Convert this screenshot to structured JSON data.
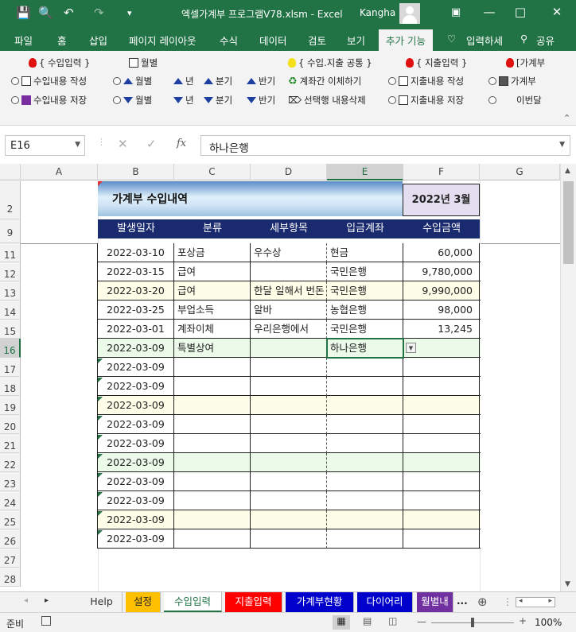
{
  "window": {
    "title": "엑셀가계부 프로그램V78.xlsm  -  Excel",
    "user": "Kangha",
    "controls": [
      "—",
      "□",
      "✕"
    ]
  },
  "quick_access": {
    "save_icon": "💾",
    "preview_icon": "🔍",
    "undo": "↶",
    "redo": "↷",
    "more": "▾"
  },
  "tabs": [
    {
      "label": "파일"
    },
    {
      "label": "홈"
    },
    {
      "label": "삽입"
    },
    {
      "label": "페이지 레이아웃"
    },
    {
      "label": "수식"
    },
    {
      "label": "데이터"
    },
    {
      "label": "검토"
    },
    {
      "label": "보기"
    },
    {
      "label": "추가 기능"
    },
    {
      "label": "입력하세"
    },
    {
      "label": "공유"
    }
  ],
  "ribbon": {
    "groups": {
      "income": "{ 수입입력 }",
      "monthly": "월별",
      "common": "{ 수입.지출 공통 }",
      "expense": "{ 지출입력 }",
      "book": "[가계부"
    },
    "rows": {
      "income_write": "수입내용 작성",
      "income_save": "수입내용 저장",
      "month_up": "월별",
      "year_up": "년",
      "quarter_up": "분기",
      "half_up": "반기",
      "month_dn": "월별",
      "year_dn": "년",
      "quarter_dn": "분기",
      "half_dn": "반기",
      "transfer": "계좌간 이체하기",
      "delete_selected": "선택행 내용삭제",
      "expense_write": "지출내용 작성",
      "expense_save": "지출내용 저장",
      "book_cut": "가계부",
      "thismonth_cut": "이번달"
    }
  },
  "formula_bar": {
    "name_box": "E16",
    "fx": "fx",
    "value": "하나은행"
  },
  "columns": [
    "A",
    "B",
    "C",
    "D",
    "E",
    "F",
    "G"
  ],
  "rows": [
    "2",
    "9",
    "11",
    "12",
    "13",
    "14",
    "15",
    "16",
    "17",
    "18",
    "19",
    "20",
    "21",
    "22",
    "23",
    "24",
    "25",
    "26",
    "27",
    "28"
  ],
  "sheet": {
    "title": "가계부 수입내역",
    "period": "2022년 3월",
    "headers": [
      "발생일자",
      "분류",
      "세부항목",
      "입금계좌",
      "수입금액"
    ],
    "records": [
      {
        "date": "2022-03-10",
        "cat": "포상금",
        "detail": "우수상",
        "account": "현금",
        "amount": "60,000",
        "bg": "#ffffff"
      },
      {
        "date": "2022-03-15",
        "cat": "급여",
        "detail": "",
        "account": "국민은행",
        "amount": "9,780,000",
        "bg": "#ffffff"
      },
      {
        "date": "2022-03-20",
        "cat": "급여",
        "detail": "한달 일해서 번돈",
        "account": "국민은행",
        "amount": "9,990,000",
        "bg": "#fdfde8"
      },
      {
        "date": "2022-03-25",
        "cat": "부업소득",
        "detail": "알바",
        "account": "농협은행",
        "amount": "98,000",
        "bg": "#ffffff"
      },
      {
        "date": "2022-03-01",
        "cat": "계좌이체",
        "detail": "우리은행에서",
        "account": "국민은행",
        "amount": "13,245",
        "bg": "#ffffff"
      },
      {
        "date": "2022-03-09",
        "cat": "특별상여",
        "detail": "",
        "account": "하나은행",
        "amount": "",
        "bg": "#ebfae9"
      },
      {
        "date": "2022-03-09",
        "cat": "",
        "detail": "",
        "account": "",
        "amount": "",
        "bg": "#ffffff"
      },
      {
        "date": "2022-03-09",
        "cat": "",
        "detail": "",
        "account": "",
        "amount": "",
        "bg": "#ffffff"
      },
      {
        "date": "2022-03-09",
        "cat": "",
        "detail": "",
        "account": "",
        "amount": "",
        "bg": "#fdfde8"
      },
      {
        "date": "2022-03-09",
        "cat": "",
        "detail": "",
        "account": "",
        "amount": "",
        "bg": "#ffffff"
      },
      {
        "date": "2022-03-09",
        "cat": "",
        "detail": "",
        "account": "",
        "amount": "",
        "bg": "#ffffff"
      },
      {
        "date": "2022-03-09",
        "cat": "",
        "detail": "",
        "account": "",
        "amount": "",
        "bg": "#ebfae9"
      },
      {
        "date": "2022-03-09",
        "cat": "",
        "detail": "",
        "account": "",
        "amount": "",
        "bg": "#ffffff"
      },
      {
        "date": "2022-03-09",
        "cat": "",
        "detail": "",
        "account": "",
        "amount": "",
        "bg": "#ffffff"
      },
      {
        "date": "2022-03-09",
        "cat": "",
        "detail": "",
        "account": "",
        "amount": "",
        "bg": "#fdfde8"
      },
      {
        "date": "2022-03-09",
        "cat": "",
        "detail": "",
        "account": "",
        "amount": "",
        "bg": "#ffffff"
      }
    ]
  },
  "sheet_tabs": [
    {
      "label": "Help",
      "bg": "#f2f2f2",
      "fg": "#333333"
    },
    {
      "label": "설정",
      "bg": "#ffc000",
      "fg": "#222222"
    },
    {
      "label": "수입입력",
      "bg": "#ffffff",
      "fg": "#217346"
    },
    {
      "label": "지출입력",
      "bg": "#ff0000",
      "fg": "#ffffff"
    },
    {
      "label": "가계부현황",
      "bg": "#0000cc",
      "fg": "#ffffff"
    },
    {
      "label": "다이어리",
      "bg": "#0000cc",
      "fg": "#ffffff"
    },
    {
      "label": "월별내",
      "bg": "#7030a0",
      "fg": "#ffffff"
    }
  ],
  "sheet_nav": {
    "next": "▸",
    "more": "...",
    "add": "⊕"
  },
  "status": {
    "mode": "준비",
    "zoom": "100%",
    "minus": "—",
    "plus": "+"
  },
  "colors": {
    "accent": "#217346",
    "header_navy": "#1a2a6e"
  }
}
